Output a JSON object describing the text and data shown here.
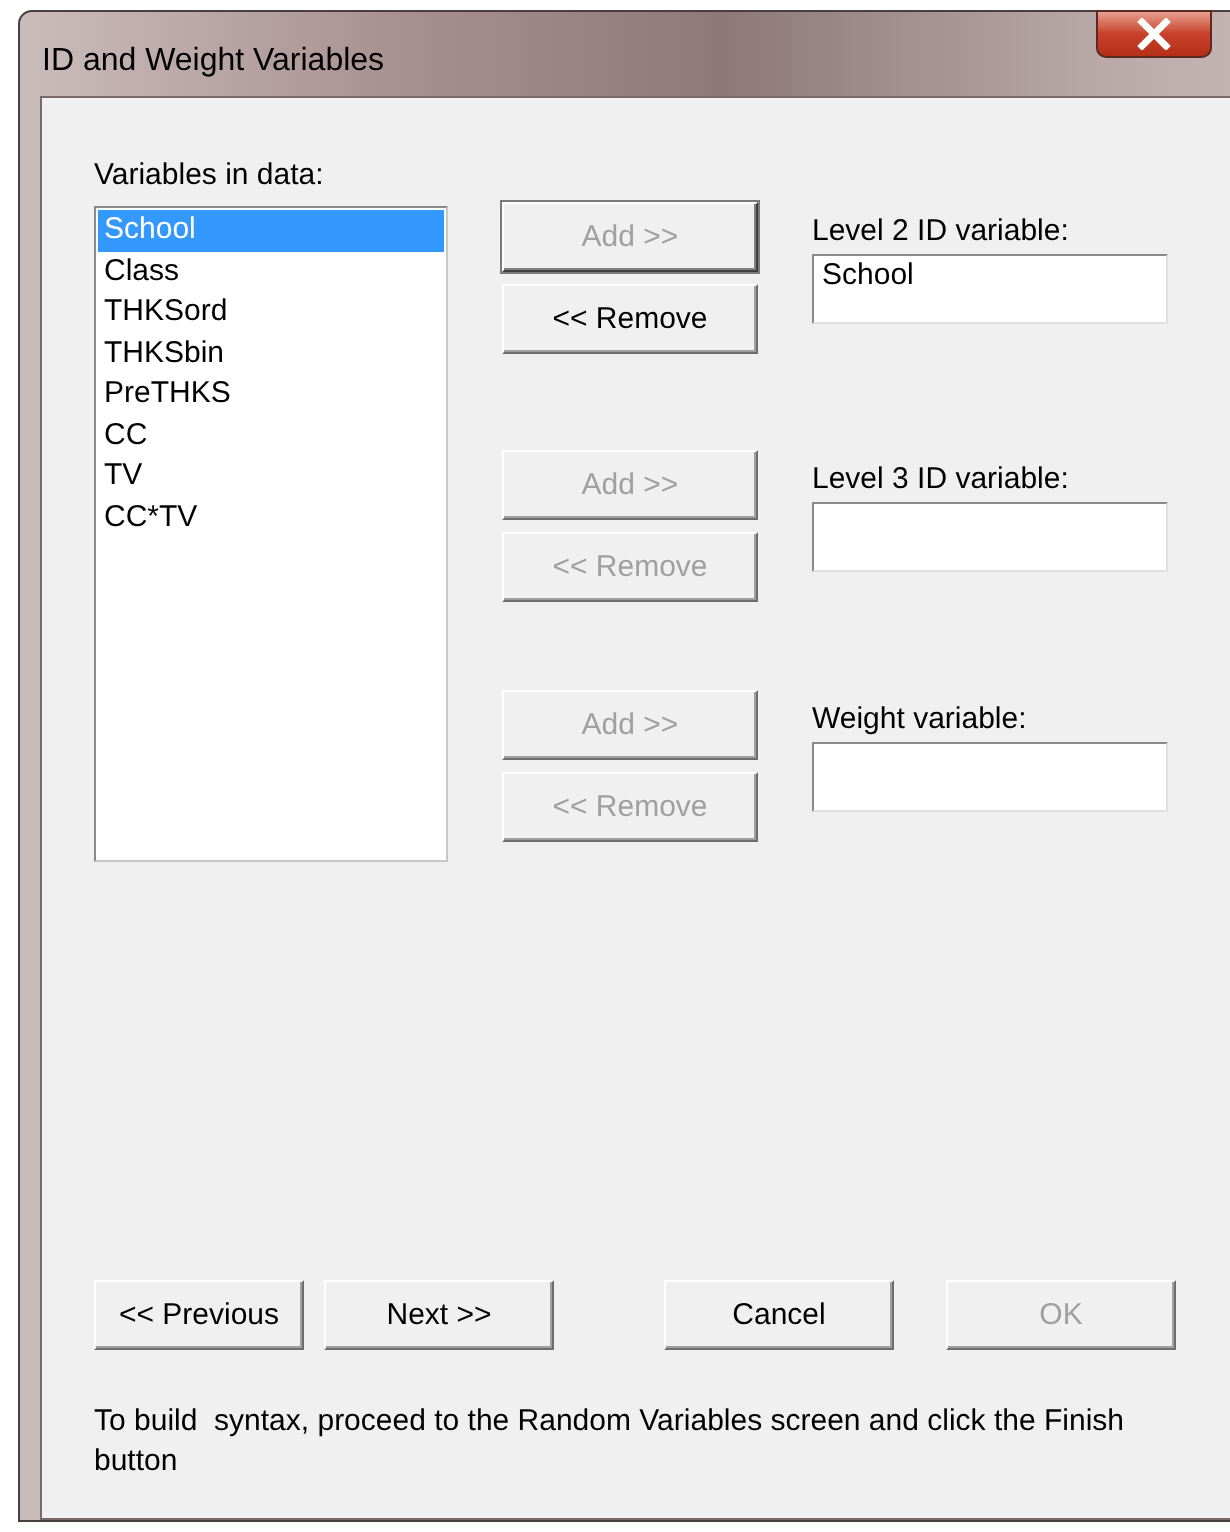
{
  "window": {
    "title": "ID and Weight Variables"
  },
  "variables": {
    "label": "Variables in data:",
    "items": [
      {
        "name": "School",
        "selected": true
      },
      {
        "name": "Class",
        "selected": false
      },
      {
        "name": "THKSord",
        "selected": false
      },
      {
        "name": "THKSbin",
        "selected": false
      },
      {
        "name": "PreTHKS",
        "selected": false
      },
      {
        "name": "CC",
        "selected": false
      },
      {
        "name": "TV",
        "selected": false
      },
      {
        "name": "CC*TV",
        "selected": false
      }
    ]
  },
  "id_groups": [
    {
      "add": {
        "label": "Add >>",
        "disabled": true,
        "focused": true
      },
      "remove": {
        "label": "<< Remove",
        "disabled": false,
        "focused": false
      },
      "label": "Level 2 ID variable:",
      "value": "School"
    },
    {
      "add": {
        "label": "Add >>",
        "disabled": true,
        "focused": false
      },
      "remove": {
        "label": "<< Remove",
        "disabled": true,
        "focused": false
      },
      "label": "Level 3 ID variable:"
    },
    {
      "add": {
        "label": "Add >>",
        "disabled": true,
        "focused": false
      },
      "remove": {
        "label": "<< Remove",
        "disabled": true,
        "focused": false
      },
      "label": "Weight variable:"
    }
  ],
  "nav_buttons": [
    {
      "label": "<< Previous",
      "disabled": false
    },
    {
      "label": "Next >>",
      "disabled": false
    },
    {
      "label": "Cancel",
      "disabled": false
    },
    {
      "label": "OK",
      "disabled": true
    }
  ],
  "hint": "To build  syntax, proceed to the Random Variables screen and click the Finish button"
}
